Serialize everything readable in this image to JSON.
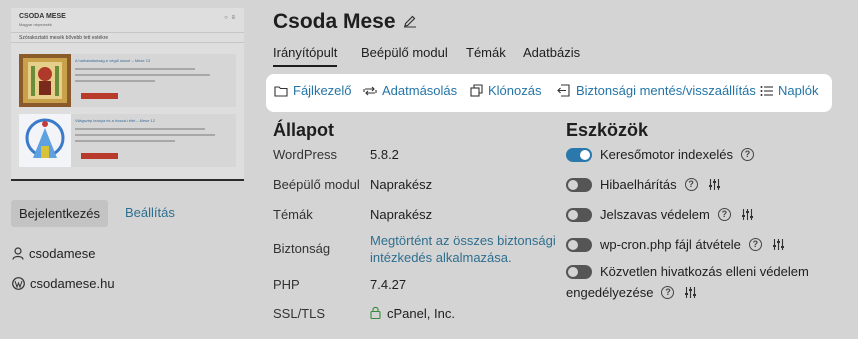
{
  "site": {
    "title": "Csoda Mese",
    "thumbnail": {
      "header_title": "CSODA MESE",
      "header_sub": "Magyar népmesék",
      "bar_text": "Szórakoztató mesék bővebb tett estékre",
      "card1_title": "A halhatatlanság-e végül ússzé – Mese 13",
      "card2_title": "Világszép leánya és a hosszú élet – Mese 12"
    }
  },
  "sidebar": {
    "login_label": "Bejelentkezés",
    "settings_label": "Beállítás",
    "user": "csodamese",
    "domain": "csodamese.hu"
  },
  "tabs": [
    {
      "label": "Irányítópult",
      "active": true
    },
    {
      "label": "Beépülő modul",
      "active": false
    },
    {
      "label": "Témák",
      "active": false
    },
    {
      "label": "Adatbázis",
      "active": false
    }
  ],
  "toolbar": {
    "file_manager": "Fájlkezelő",
    "data_copy": "Adatmásolás",
    "cloning": "Klónozás",
    "backup": "Biztonsági mentés/visszaállítás",
    "logs": "Naplók"
  },
  "status": {
    "heading": "Állapot",
    "rows": [
      {
        "key": "WordPress",
        "value": "5.8.2"
      },
      {
        "key": "Beépülő modul",
        "value": "Naprakész"
      },
      {
        "key": "Témák",
        "value": "Naprakész"
      },
      {
        "key": "Biztonság",
        "value_line1": "Megtörtént az összes biztonsági",
        "value_line2": "intézkedés alkalmazása."
      },
      {
        "key": "PHP",
        "value": "7.4.27"
      },
      {
        "key": "SSL/TLS",
        "value": "cPanel, Inc."
      }
    ]
  },
  "tools": {
    "heading": "Eszközök",
    "items": [
      {
        "label": "Keresőmotor indexelés",
        "on": true,
        "has_settings": false
      },
      {
        "label": "Hibaelhárítás",
        "on": false,
        "has_settings": true
      },
      {
        "label": "Jelszavas védelem",
        "on": false,
        "has_settings": true
      },
      {
        "label": "wp-cron.php fájl átvétele",
        "on": false,
        "has_settings": true
      },
      {
        "label_line1": "Közvetlen hivatkozás elleni védelem",
        "label_line2": "engedélyezése",
        "on": false,
        "has_settings": true
      }
    ]
  },
  "colors": {
    "accent": "#2475a7",
    "toggle_on": "#2a78ac",
    "background": "#d4d4d4"
  }
}
